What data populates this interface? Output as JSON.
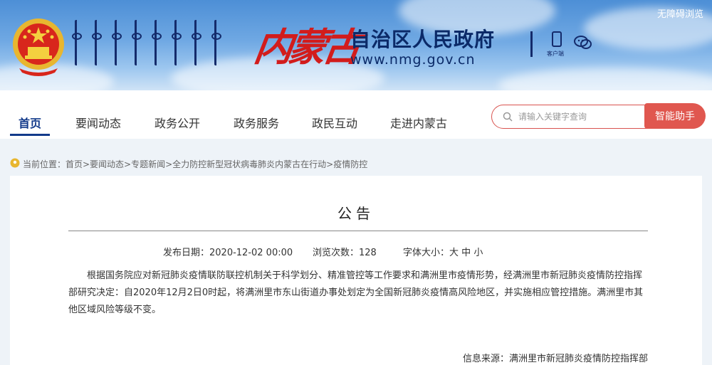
{
  "header": {
    "site_title": "自治区人民政府",
    "site_url": "www.nmg.gov.cn",
    "calligraphy": "内蒙古",
    "accessibility_link": "无障碍浏览",
    "client_label": "客户端",
    "icons": [
      "national-emblem-icon",
      "mongolian-script-logo",
      "phone-icon",
      "wechat-icon"
    ]
  },
  "nav": {
    "items": [
      {
        "label": "首页",
        "active": true
      },
      {
        "label": "要闻动态",
        "active": false
      },
      {
        "label": "政务公开",
        "active": false
      },
      {
        "label": "政务服务",
        "active": false
      },
      {
        "label": "政民互动",
        "active": false
      },
      {
        "label": "走进内蒙古",
        "active": false
      }
    ],
    "search_placeholder": "请输入关键字查询",
    "ai_button": "智能助手"
  },
  "breadcrumb": {
    "text": "当前位置：首页>要闻动态>专题新闻>全力防控新型冠状病毒肺炎内蒙古在行动>疫情防控"
  },
  "article": {
    "title": "公告",
    "publish_date": "发布日期：2020-12-02 00:00",
    "views": "浏览次数：128",
    "font_size_label": "字体大小：",
    "font_sizes": [
      "大",
      "中",
      "小"
    ],
    "body": "根据国务院应对新冠肺炎疫情联防联控机制关于科学划分、精准管控等工作要求和满洲里市疫情形势，经满洲里市新冠肺炎疫情防控指挥部研究决定：自2020年12月2日0时起，将满洲里市东山街道办事处划定为全国新冠肺炎疫情高风险地区，并实施相应管控措施。满洲里市其他区域风险等级不变。",
    "source": "信息来源：满洲里市新冠肺炎疫情防控指挥部"
  },
  "colors": {
    "brand_blue": "#123a8a",
    "accent_red": "#e0574f",
    "calligraphy_red": "#d21c1c"
  }
}
